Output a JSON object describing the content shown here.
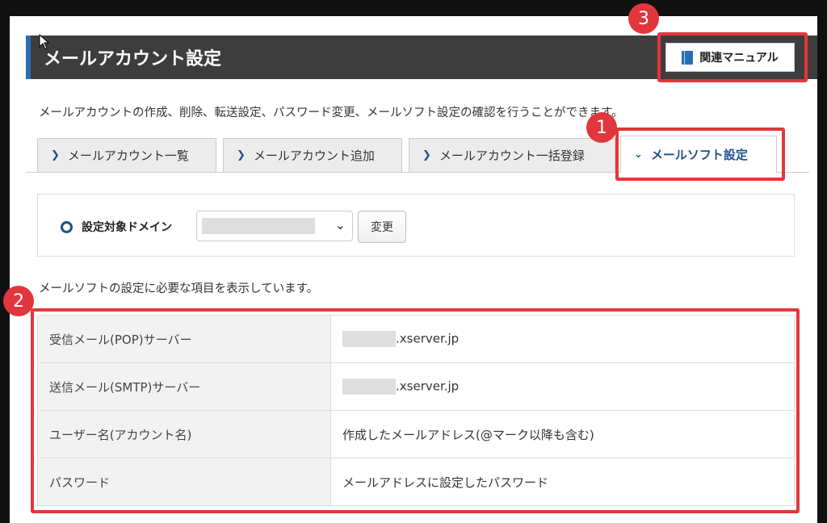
{
  "header": {
    "title": "メールアカウント設定",
    "manual_label": "関連マニュアル"
  },
  "description": "メールアカウントの作成、削除、転送設定、パスワード変更、メールソフト設定の確認を行うことができます。",
  "tabs": [
    {
      "label": "メールアカウント一覧",
      "active": false
    },
    {
      "label": "メールアカウント追加",
      "active": false
    },
    {
      "label": "メールアカウント一括登録",
      "active": false
    },
    {
      "label": "メールソフト設定",
      "active": true
    }
  ],
  "domain": {
    "label": "設定対象ドメイン",
    "change_label": "変更"
  },
  "info_text": "メールソフトの設定に必要な項目を表示しています。",
  "settings": [
    {
      "key": "受信メール(POP)サーバー",
      "value": ".xserver.jp"
    },
    {
      "key": "送信メール(SMTP)サーバー",
      "value": ".xserver.jp"
    },
    {
      "key": "ユーザー名(アカウント名)",
      "value": "作成したメールアドレス(@マーク以降も含む)"
    },
    {
      "key": "パスワード",
      "value": "メールアドレスに設定したパスワード"
    }
  ],
  "badges": [
    "1",
    "2",
    "3"
  ],
  "colors": {
    "accent": "#2a6db5",
    "highlight": "#e2363d",
    "header_bg": "#3d3d3d"
  }
}
